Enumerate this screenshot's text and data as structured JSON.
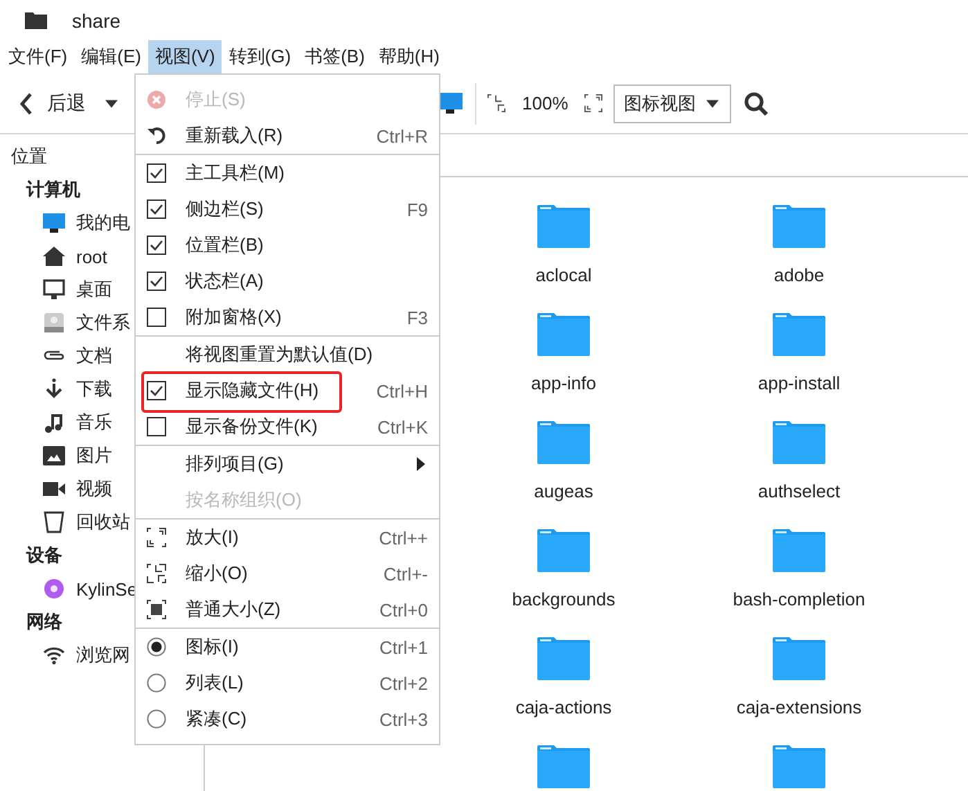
{
  "window": {
    "title": "share"
  },
  "menubar": [
    {
      "label": "文件(F)",
      "selected": false
    },
    {
      "label": "编辑(E)",
      "selected": false
    },
    {
      "label": "视图(V)",
      "selected": true
    },
    {
      "label": "转到(G)",
      "selected": false
    },
    {
      "label": "书签(B)",
      "selected": false
    },
    {
      "label": "帮助(H)",
      "selected": false
    }
  ],
  "toolbar": {
    "back_label": "后退",
    "zoom": "100%",
    "view_mode": "图标视图"
  },
  "sidebar": {
    "title": "位置",
    "sections": [
      {
        "heading": "计算机",
        "items": [
          {
            "label": "我的电",
            "kind": "computer"
          },
          {
            "label": "root",
            "kind": "home"
          },
          {
            "label": "桌面",
            "kind": "desktop"
          },
          {
            "label": "文件系",
            "kind": "drive"
          },
          {
            "label": "文档",
            "kind": "documents"
          },
          {
            "label": "下载",
            "kind": "download"
          },
          {
            "label": "音乐",
            "kind": "music"
          },
          {
            "label": "图片",
            "kind": "pictures"
          },
          {
            "label": "视频",
            "kind": "video"
          },
          {
            "label": "回收站",
            "kind": "trash"
          }
        ]
      },
      {
        "heading": "设备",
        "items": [
          {
            "label": "KylinSe",
            "kind": "disc"
          }
        ]
      },
      {
        "heading": "网络",
        "items": [
          {
            "label": "浏览网",
            "kind": "network"
          }
        ]
      }
    ]
  },
  "files": [
    {
      "name": "aclocal",
      "kind": "folder"
    },
    {
      "name": "adobe",
      "kind": "folder"
    },
    {
      "name": "app-info",
      "kind": "folder"
    },
    {
      "name": "app-install",
      "kind": "folder"
    },
    {
      "name": "augeas",
      "kind": "folder"
    },
    {
      "name": "authselect",
      "kind": "folder"
    },
    {
      "name": "backgrounds",
      "kind": "folder"
    },
    {
      "name": "bash-completion",
      "kind": "folder"
    },
    {
      "name": "caja-actions",
      "kind": "folder"
    },
    {
      "name": "caja-extensions",
      "kind": "folder"
    },
    {
      "kind": "folder"
    },
    {
      "kind": "folder"
    }
  ],
  "view_menu": {
    "groups": [
      [
        {
          "kind": "stop",
          "label": "停止(S)",
          "disabled": true
        },
        {
          "kind": "reload",
          "label": "重新载入(R)",
          "shortcut": "Ctrl+R",
          "disabled": false
        }
      ],
      [
        {
          "kind": "check",
          "label": "主工具栏(M)",
          "checked": true
        },
        {
          "kind": "check",
          "label": "侧边栏(S)",
          "checked": true,
          "shortcut": "F9"
        },
        {
          "kind": "check",
          "label": "位置栏(B)",
          "checked": true
        },
        {
          "kind": "check",
          "label": "状态栏(A)",
          "checked": true
        },
        {
          "kind": "check",
          "label": "附加窗格(X)",
          "checked": false,
          "shortcut": "F3"
        }
      ],
      [
        {
          "kind": "action",
          "label": "将视图重置为默认值(D)",
          "disabled": false
        },
        {
          "kind": "check",
          "label": "显示隐藏文件(H)",
          "checked": true,
          "shortcut": "Ctrl+H",
          "highlighted": true
        },
        {
          "kind": "check",
          "label": "显示备份文件(K)",
          "checked": false,
          "shortcut": "Ctrl+K"
        }
      ],
      [
        {
          "kind": "submenu",
          "label": "排列项目(G)"
        },
        {
          "kind": "action",
          "label": "按名称组织(O)",
          "disabled": true
        }
      ],
      [
        {
          "kind": "zoomin",
          "label": "放大(I)",
          "shortcut": "Ctrl++",
          "disabled": false
        },
        {
          "kind": "zoomout",
          "label": "缩小(O)",
          "shortcut": "Ctrl+-",
          "disabled": false
        },
        {
          "kind": "normalsize",
          "label": "普通大小(Z)",
          "shortcut": "Ctrl+0",
          "disabled": false
        }
      ],
      [
        {
          "kind": "radio",
          "label": "图标(I)",
          "selected": true,
          "shortcut": "Ctrl+1"
        },
        {
          "kind": "radio",
          "label": "列表(L)",
          "selected": false,
          "shortcut": "Ctrl+2"
        },
        {
          "kind": "radio",
          "label": "紧凑(C)",
          "selected": false,
          "shortcut": "Ctrl+3"
        }
      ]
    ]
  }
}
